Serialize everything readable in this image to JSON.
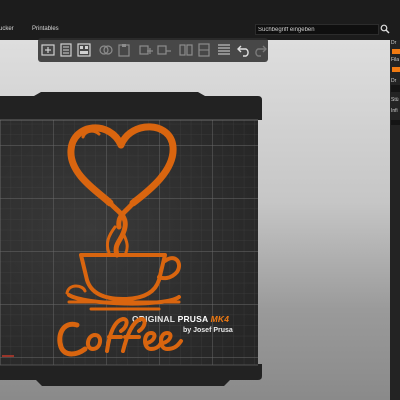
{
  "menu": {
    "items": [
      {
        "label": "ucker"
      },
      {
        "label": "Printables"
      }
    ],
    "search": {
      "placeholder": "Suchbegriff eingeben"
    }
  },
  "toolbar": {
    "buttons": [
      "add-icon",
      "delete-icon",
      "arrange-icon",
      "copy-icon",
      "paste-icon",
      "add-instance-icon",
      "remove-instance-icon",
      "split-objects-icon",
      "split-parts-icon",
      "layers-icon",
      "undo-icon",
      "redo-icon"
    ]
  },
  "right_panel": {
    "lines": [
      "Dr",
      "Fila",
      "Dr",
      "Stü",
      "Infi"
    ]
  },
  "bed": {
    "brand_original": "ORIGINAL",
    "brand_prusa": "PRUSA",
    "brand_model": "MK4",
    "brand_sub": "by Josef Prusa"
  },
  "model": {
    "name": "Coffee"
  },
  "colors": {
    "accent": "#f07a12",
    "bed": "#2c2c2c",
    "grid": "#5a5a5a",
    "menubar": "#1c1c1c"
  }
}
